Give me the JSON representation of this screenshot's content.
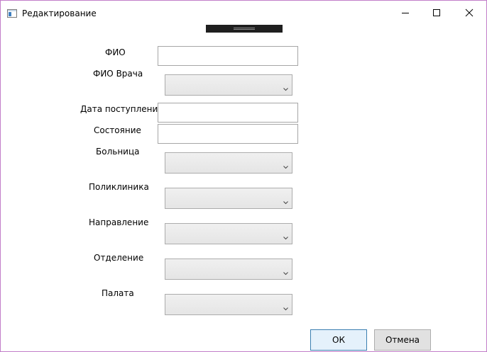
{
  "window": {
    "title": "Редактирование"
  },
  "form": {
    "fio_label": "ФИО",
    "doctor_label": "ФИО Врача",
    "admission_date_label": "Дата поступления",
    "condition_label": "Состояние",
    "hospital_label": "Больница",
    "polyclinic_label": "Поликлиника",
    "referral_label": "Направление",
    "department_label": "Отделение",
    "ward_label": "Палата",
    "fio_value": "",
    "admission_date_value": "",
    "condition_value": "",
    "doctor_selected": "",
    "hospital_selected": "",
    "polyclinic_selected": "",
    "referral_selected": "",
    "department_selected": "",
    "ward_selected": ""
  },
  "buttons": {
    "ok_label": "ОК",
    "cancel_label": "Отмена"
  },
  "icons": {
    "app": "window-app-icon",
    "minimize": "minimize-icon",
    "maximize": "maximize-icon",
    "close": "close-icon",
    "dropdown": "chevron-down-icon"
  }
}
